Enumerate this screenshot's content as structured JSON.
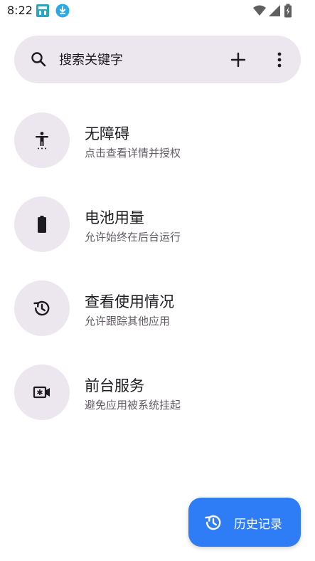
{
  "status_bar": {
    "time": "8:22"
  },
  "search": {
    "placeholder": "搜索关键字"
  },
  "permissions": [
    {
      "title": "无障碍",
      "subtitle": "点击查看详情并授权",
      "icon": "accessibility-icon"
    },
    {
      "title": "电池用量",
      "subtitle": "允许始终在后台运行",
      "icon": "battery-icon"
    },
    {
      "title": "查看使用情况",
      "subtitle": "允许跟踪其他应用",
      "icon": "history-icon"
    },
    {
      "title": "前台服务",
      "subtitle": "避免应用被系统挂起",
      "icon": "foreground-service-icon"
    }
  ],
  "fab": {
    "label": "历史记录",
    "icon": "history-icon"
  },
  "colors": {
    "search_bg": "#ece6ee",
    "icon_circle_bg": "#ece6ee",
    "fab_bg": "#2f7df6",
    "subtitle": "#625b66"
  }
}
